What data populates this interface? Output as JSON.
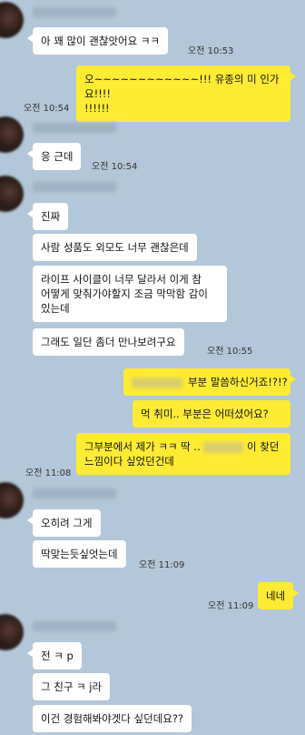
{
  "messages": {
    "m1": "아 꽤 많이 괜찮앗어요 ㅋㅋ",
    "t1": "오전 10:53",
    "m2_line1": "오~~~~~~~~~~~~!!! 유종의 미 인가요!!!!",
    "m2_line2": "!!!!!!",
    "t2": "오전 10:54",
    "m3": "응 근데",
    "t3": "오전 10:54",
    "m4": "진짜",
    "m5": "사람 성품도 외모도 너무 괜찮은데",
    "m6_line1": "라이프 사이클이 너무 달라서 이게 참",
    "m6_line2": "어떻게 맞춰가야할지 조금 막막함 감이",
    "m6_line3": "있는데",
    "m7": "그래도 일단 좀더 만나보려구요",
    "t7": "오전 10:55",
    "m8": "부분 말씀하신거죠!?!?",
    "m9": "먹 취미.. 부분은 어떠셨어요?",
    "m10_line1a": "그부분에서 제가 ㅋㅋ 딱 ..",
    "m10_line1b": "이 찾던",
    "m10_line2": "느낌이다 싶었던건데",
    "t10": "오전 11:08",
    "m11": "오히려 그게",
    "m12": "딱맞는듯싶엇는데",
    "t12": "오전 11:09",
    "m13": "네네",
    "t13": "오전 11:09",
    "m14": "전 ㅋ p",
    "m15": "그 친구 ㅋ j라",
    "m16": "이건 경험해봐야겟다 싶던데요??"
  },
  "colors": {
    "background": "#b2c7d9",
    "incoming_bubble": "#ffffff",
    "outgoing_bubble": "#ffeb33"
  }
}
